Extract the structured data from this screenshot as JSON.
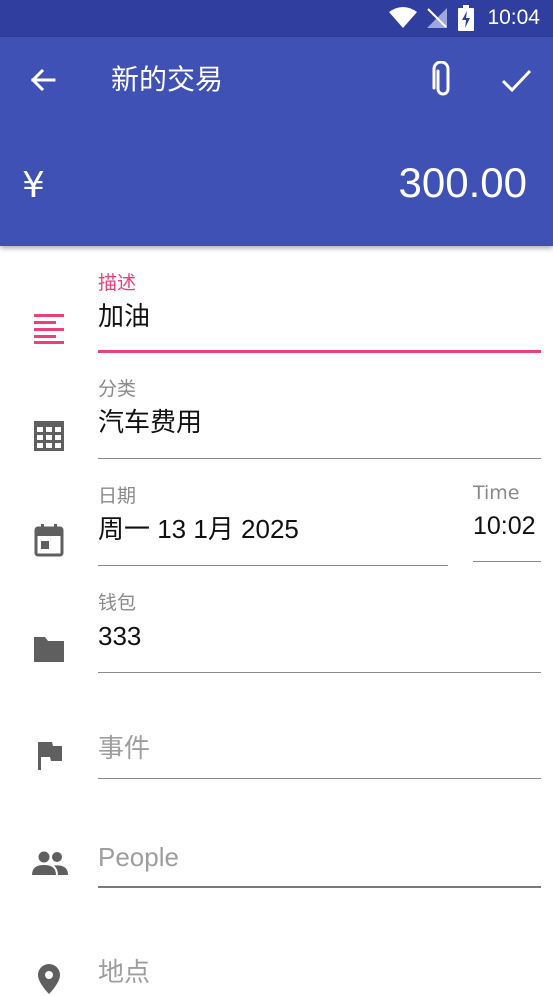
{
  "status_bar": {
    "time": "10:04"
  },
  "app_bar": {
    "title": "新的交易",
    "currency_symbol": "¥",
    "amount": "300.00",
    "color": "#3F51B5"
  },
  "form": {
    "accent": "#EC407A",
    "description": {
      "label": "描述",
      "value": "加油"
    },
    "category": {
      "label": "分类",
      "value": "汽车费用"
    },
    "date": {
      "label": "日期",
      "value": "周一 13 1月 2025"
    },
    "time": {
      "label": "Time",
      "value": "10:02"
    },
    "wallet": {
      "label": "钱包",
      "value": "333"
    },
    "event": {
      "placeholder": "事件"
    },
    "people": {
      "placeholder": "People"
    },
    "location": {
      "placeholder": "地点"
    }
  }
}
